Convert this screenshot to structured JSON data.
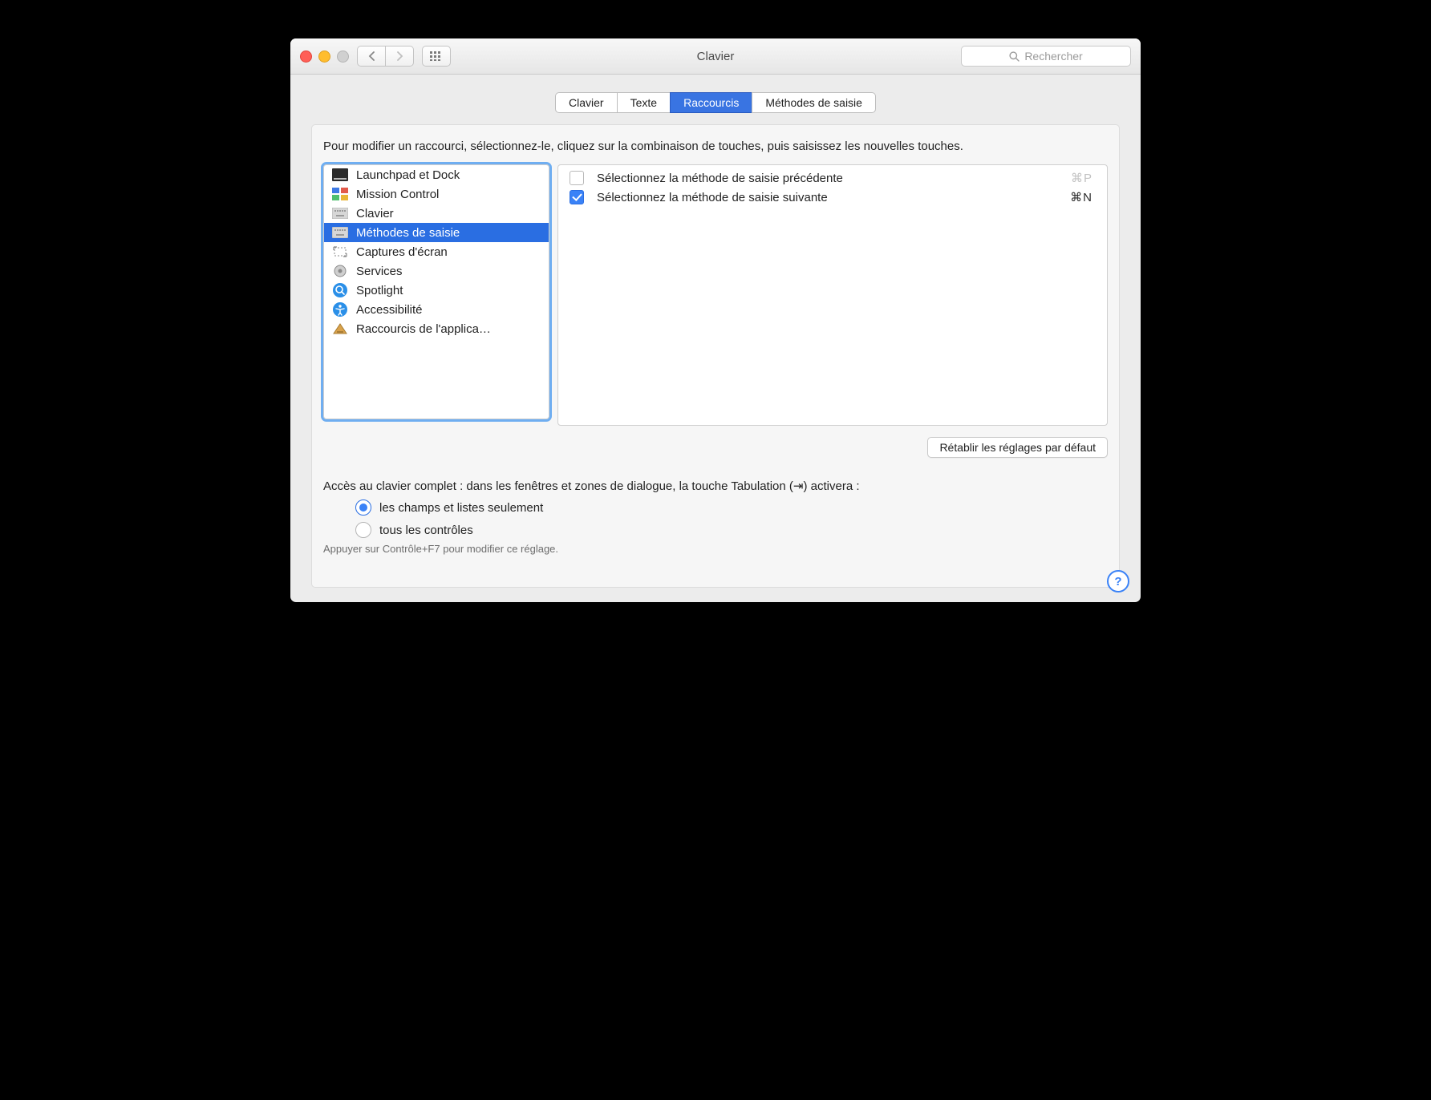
{
  "header": {
    "title": "Clavier",
    "search_placeholder": "Rechercher"
  },
  "tabs": [
    {
      "label": "Clavier",
      "selected": false
    },
    {
      "label": "Texte",
      "selected": false
    },
    {
      "label": "Raccourcis",
      "selected": true
    },
    {
      "label": "Méthodes de saisie",
      "selected": false
    }
  ],
  "panel": {
    "instructions": "Pour modifier un raccourci, sélectionnez-le, cliquez sur la combinaison de touches, puis saisissez les nouvelles touches.",
    "categories": [
      {
        "label": "Launchpad et Dock",
        "icon": "launchpad"
      },
      {
        "label": "Mission Control",
        "icon": "mission"
      },
      {
        "label": "Clavier",
        "icon": "keyboard"
      },
      {
        "label": "Méthodes de saisie",
        "icon": "keyboard",
        "selected": true
      },
      {
        "label": "Captures d'écran",
        "icon": "screenshot"
      },
      {
        "label": "Services",
        "icon": "gear"
      },
      {
        "label": "Spotlight",
        "icon": "spotlight"
      },
      {
        "label": "Accessibilité",
        "icon": "accessibility"
      },
      {
        "label": "Raccourcis de l'applica…",
        "icon": "appshortcut"
      }
    ],
    "shortcuts": [
      {
        "checked": false,
        "label": "Sélectionnez la méthode de saisie précédente",
        "key": "⌘P",
        "disabled": true
      },
      {
        "checked": true,
        "label": "Sélectionnez la méthode de saisie suivante",
        "key": "⌘N",
        "disabled": false
      }
    ],
    "restore_label": "Rétablir les réglages par défaut"
  },
  "fka": {
    "prompt": "Accès au clavier complet : dans les fenêtres et zones de dialogue, la touche Tabulation (⇥) activera :",
    "options": [
      {
        "label": "les champs et listes seulement",
        "checked": true
      },
      {
        "label": "tous les contrôles",
        "checked": false
      }
    ],
    "hint": "Appuyer sur Contrôle+F7 pour modifier ce réglage."
  },
  "help": "?"
}
